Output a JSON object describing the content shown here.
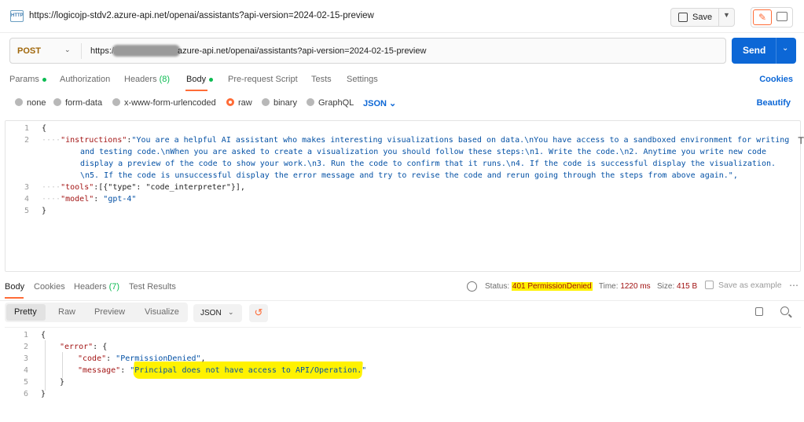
{
  "header": {
    "request_title": "https://logicojp-stdv2.azure-api.net/openai/assistants?api-version=2024-02-15-preview",
    "http_icon_text": "HTTP",
    "save_label": "Save"
  },
  "url_bar": {
    "method": "POST",
    "url_prefix": "https://",
    "url_rest": "azure-api.net/openai/assistants?api-version=2024-02-15-preview",
    "send_label": "Send"
  },
  "request_tabs": {
    "params": "Params",
    "authorization": "Authorization",
    "headers": "Headers",
    "headers_count": "(8)",
    "body": "Body",
    "pre_request": "Pre-request Script",
    "tests": "Tests",
    "settings": "Settings",
    "cookies": "Cookies"
  },
  "body_types": {
    "none": "none",
    "form_data": "form-data",
    "urlencoded": "x-www-form-urlencoded",
    "raw": "raw",
    "binary": "binary",
    "graphql": "GraphQL",
    "format": "JSON",
    "beautify": "Beautify"
  },
  "request_body": {
    "line_numbers": [
      "1",
      "2",
      "3",
      "4",
      "5"
    ],
    "line1": "{",
    "instructions_key": "\"instructions\"",
    "instructions_l1": "\"You are a helpful AI assistant who makes interesting visualizations based on data.\\nYou have access to a sandboxed environment for writing",
    "instructions_l2": "and testing code.\\nWhen you are asked to create a visualization you should follow these steps:\\n1. Write the code.\\n2. Anytime you write new code",
    "instructions_l3": "display a preview of the code to show your work.\\n3. Run the code to confirm that it runs.\\n4. If the code is successful display the visualization.",
    "instructions_l4": "\\n5. If the code is unsuccessful display the error message and try to revise the code and rerun going through the steps from above again.\",",
    "tools_key": "\"tools\"",
    "tools_val": ":[{\"type\": \"code_interpreter\"}],",
    "model_key": "\"model\"",
    "model_val": "\"gpt-4\"",
    "line5": "}"
  },
  "response_tabs": {
    "body": "Body",
    "cookies": "Cookies",
    "headers": "Headers",
    "headers_count": "(7)",
    "test_results": "Test Results"
  },
  "response_meta": {
    "status_label": "Status:",
    "status_value": "401 PermissionDenied",
    "time_label": "Time:",
    "time_value": "1220 ms",
    "size_label": "Size:",
    "size_value": "415 B",
    "save_example": "Save as example"
  },
  "response_view": {
    "pretty": "Pretty",
    "raw": "Raw",
    "preview": "Preview",
    "visualize": "Visualize",
    "format": "JSON"
  },
  "response_body": {
    "line_numbers": [
      "1",
      "2",
      "3",
      "4",
      "5",
      "6"
    ],
    "line1": "{",
    "error_key": "\"error\"",
    "code_key": "\"code\"",
    "code_val": "\"PermissionDenied\"",
    "message_key": "\"message\"",
    "message_val": "\"Principal does not have access to API/Operation.\"",
    "line5": "}",
    "line6": "}"
  },
  "colors": {
    "accent": "#ff6c37",
    "send": "#0c67d6",
    "highlight": "#fff200",
    "status_dot": "#0cbb52"
  }
}
